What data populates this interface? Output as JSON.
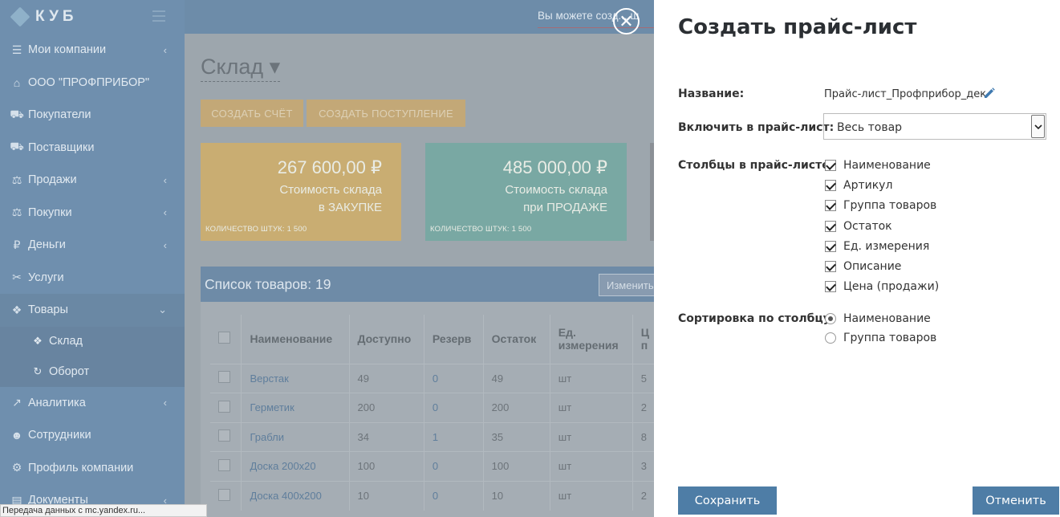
{
  "app": {
    "logo_text": "КУБ",
    "topbar_text": "Вы можете созд... щ"
  },
  "sidebar": {
    "items": [
      {
        "label": "Мои компании",
        "icon": "list-icon",
        "chevron": "‹"
      },
      {
        "label": "ООО \"ПРОФПРИБОР\"",
        "icon": "home-icon",
        "chevron": ""
      },
      {
        "label": "Покупатели",
        "icon": "cart-icon",
        "chevron": ""
      },
      {
        "label": "Поставщики",
        "icon": "truck-icon",
        "chevron": ""
      },
      {
        "label": "Продажи",
        "icon": "sales-icon",
        "chevron": "‹"
      },
      {
        "label": "Покупки",
        "icon": "purchases-icon",
        "chevron": "‹"
      },
      {
        "label": "Деньги",
        "icon": "ruble-icon",
        "chevron": "‹"
      },
      {
        "label": "Услуги",
        "icon": "tools-icon",
        "chevron": ""
      },
      {
        "label": "Товары",
        "icon": "boxes-icon",
        "chevron": "⌄"
      }
    ],
    "sub_items": [
      {
        "label": "Склад",
        "icon": "boxes-icon"
      },
      {
        "label": "Оборот",
        "icon": "refresh-icon"
      }
    ],
    "items_after": [
      {
        "label": "Аналитика",
        "icon": "chart-icon",
        "chevron": "‹"
      },
      {
        "label": "Сотрудники",
        "icon": "users-icon",
        "chevron": ""
      },
      {
        "label": "Профиль компании",
        "icon": "gear-icon",
        "chevron": ""
      },
      {
        "label": "Документы",
        "icon": "document-icon",
        "chevron": "‹"
      }
    ]
  },
  "main": {
    "title": "Склад",
    "buttons": {
      "create_invoice": "СОЗДАТЬ СЧЁТ",
      "create_receipt": "СОЗДАТЬ ПОСТУПЛЕНИЕ"
    },
    "cards": [
      {
        "amount": "267 600,00 ₽",
        "line1": "Стоимость склада",
        "line2": "в ЗАКУПКЕ",
        "qty": "КОЛИЧЕСТВО ШТУК: 1 500",
        "color": "#c9ad72"
      },
      {
        "amount": "485 000,00 ₽",
        "line1": "Стоимость склада",
        "line2": "при ПРОДАЖЕ",
        "qty": "КОЛИЧЕСТВО ШТУК: 1 500",
        "color": "#79a8a3"
      }
    ],
    "table": {
      "title": "Список товаров: 19",
      "change_button": "Изменить",
      "columns": [
        "Наименование",
        "Доступно",
        "Резерв",
        "Остаток",
        "Ед. измерения",
        "Ц п"
      ],
      "rows": [
        [
          "Верстак",
          "49",
          "0",
          "49",
          "шт",
          "5"
        ],
        [
          "Герметик",
          "200",
          "0",
          "200",
          "шт",
          "2"
        ],
        [
          "Грабли",
          "34",
          "1",
          "35",
          "шт",
          "8"
        ],
        [
          "Доска 200х20",
          "100",
          "0",
          "100",
          "шт",
          "3"
        ],
        [
          "Доска 400х200",
          "10",
          "0",
          "10",
          "шт",
          "2"
        ]
      ]
    }
  },
  "status_bar": {
    "text": "Передача данных с mc.yandex.ru..."
  },
  "modal": {
    "close_glyph": "✕",
    "title": "Создать прайс-лист",
    "name_label": "Название:",
    "name_value": "Прайс-лист_Профприбор_дек",
    "include_label": "Включить в прайс-лист:",
    "include_value": "Весь товар",
    "columns_label": "Столбцы в прайс-листе:",
    "columns": [
      {
        "label": "Наименование",
        "checked": true
      },
      {
        "label": "Артикул",
        "checked": true
      },
      {
        "label": "Группа товаров",
        "checked": true
      },
      {
        "label": "Остаток",
        "checked": true
      },
      {
        "label": "Ед. измерения",
        "checked": true
      },
      {
        "label": "Описание",
        "checked": true
      },
      {
        "label": "Цена (продажи)",
        "checked": true
      }
    ],
    "sort_label": "Сортировка по столбцу:",
    "sort_options": [
      {
        "label": "Наименование",
        "selected": true
      },
      {
        "label": "Группа товаров",
        "selected": false
      }
    ],
    "save_label": "Сохранить",
    "cancel_label": "Отменить",
    "accent_color": "#4e7da6"
  }
}
